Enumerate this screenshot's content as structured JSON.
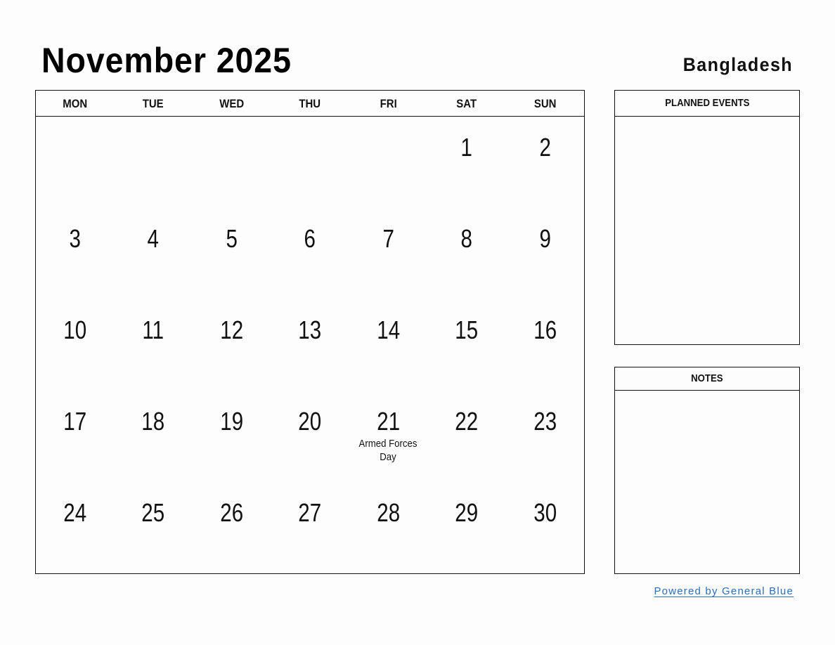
{
  "header": {
    "title": "November 2025",
    "country": "Bangladesh"
  },
  "calendar": {
    "weekdays": [
      "MON",
      "TUE",
      "WED",
      "THU",
      "FRI",
      "SAT",
      "SUN"
    ],
    "weeks": [
      [
        {
          "day": ""
        },
        {
          "day": ""
        },
        {
          "day": ""
        },
        {
          "day": ""
        },
        {
          "day": ""
        },
        {
          "day": "1"
        },
        {
          "day": "2"
        }
      ],
      [
        {
          "day": "3"
        },
        {
          "day": "4"
        },
        {
          "day": "5"
        },
        {
          "day": "6"
        },
        {
          "day": "7"
        },
        {
          "day": "8"
        },
        {
          "day": "9"
        }
      ],
      [
        {
          "day": "10"
        },
        {
          "day": "11"
        },
        {
          "day": "12"
        },
        {
          "day": "13"
        },
        {
          "day": "14"
        },
        {
          "day": "15"
        },
        {
          "day": "16"
        }
      ],
      [
        {
          "day": "17"
        },
        {
          "day": "18"
        },
        {
          "day": "19"
        },
        {
          "day": "20"
        },
        {
          "day": "21",
          "holiday": "Armed Forces Day"
        },
        {
          "day": "22"
        },
        {
          "day": "23"
        }
      ],
      [
        {
          "day": "24"
        },
        {
          "day": "25"
        },
        {
          "day": "26"
        },
        {
          "day": "27"
        },
        {
          "day": "28"
        },
        {
          "day": "29"
        },
        {
          "day": "30"
        }
      ]
    ]
  },
  "panels": {
    "planned_events": {
      "title": "PLANNED EVENTS"
    },
    "notes": {
      "title": "NOTES"
    }
  },
  "footer": {
    "powered_by": "Powered by General Blue",
    "link_color": "#2a6ebb"
  }
}
